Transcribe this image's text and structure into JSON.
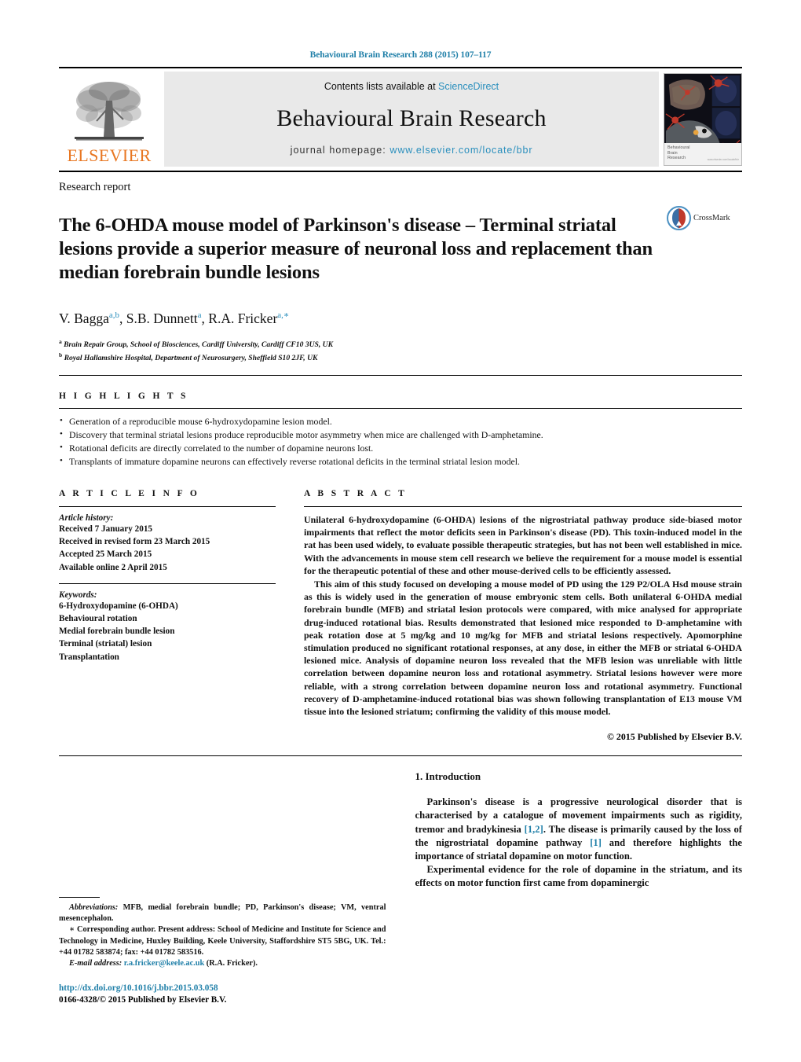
{
  "running_head": "Behavioural Brain Research 288 (2015) 107–117",
  "masthead": {
    "publisher_name": "ELSEVIER",
    "contents_prefix": "Contents lists available at ",
    "contents_link": "ScienceDirect",
    "journal_title": "Behavioural Brain Research",
    "homepage_prefix": "journal homepage: ",
    "homepage_url": "www.elsevier.com/locate/bbr",
    "cover_caption_line1": "Behavioural",
    "cover_caption_line2": "Brain",
    "cover_caption_line3": "Research",
    "cover_caption_tiny": "www.elsevier.com/locate/bbr"
  },
  "article": {
    "type_label": "Research report",
    "title": "The 6-OHDA mouse model of Parkinson's disease – Terminal striatal lesions provide a superior measure of neuronal loss and replacement than median forebrain bundle lesions",
    "crossmark_label": "CrossMark",
    "authors_html": "V. Bagga<sup>a,b</sup>, S.B. Dunnett<sup>a</sup>, R.A. Fricker<sup>a,<span class=\"ast\">∗</span></sup>",
    "affiliations": [
      {
        "marker": "a",
        "text": "Brain Repair Group, School of Biosciences, Cardiff University, Cardiff CF10 3US, UK"
      },
      {
        "marker": "b",
        "text": "Royal Hallamshire Hospital, Department of Neurosurgery, Sheffield S10 2JF, UK"
      }
    ]
  },
  "highlights": {
    "label": "H I G H L I G H T S",
    "items": [
      "Generation of a reproducible mouse 6-hydroxydopamine lesion model.",
      "Discovery that terminal striatal lesions produce reproducible motor asymmetry when mice are challenged with D-amphetamine.",
      "Rotational deficits are directly correlated to the number of dopamine neurons lost.",
      "Transplants of immature dopamine neurons can effectively reverse rotational deficits in the terminal striatal lesion model."
    ]
  },
  "article_info": {
    "label": "A R T I C L E    I N F O",
    "history_label": "Article history:",
    "history": [
      "Received 7 January 2015",
      "Received in revised form 23 March 2015",
      "Accepted 25 March 2015",
      "Available online 2 April 2015"
    ],
    "keywords_label": "Keywords:",
    "keywords": [
      "6-Hydroxydopamine (6-OHDA)",
      "Behavioural rotation",
      "Medial forebrain bundle lesion",
      "Terminal (striatal) lesion",
      "Transplantation"
    ]
  },
  "abstract": {
    "label": "A B S T R A C T",
    "paragraph_1": "Unilateral 6-hydroxydopamine (6-OHDA) lesions of the nigrostriatal pathway produce side-biased motor impairments that reflect the motor deficits seen in Parkinson's disease (PD). This toxin-induced model in the rat has been used widely, to evaluate possible therapeutic strategies, but has not been well established in mice. With the advancements in mouse stem cell research we believe the requirement for a mouse model is essential for the therapeutic potential of these and other mouse-derived cells to be efficiently assessed.",
    "paragraph_2": "This aim of this study focused on developing a mouse model of PD using the 129 P2/OLA Hsd mouse strain as this is widely used in the generation of mouse embryonic stem cells. Both unilateral 6-OHDA medial forebrain bundle (MFB) and striatal lesion protocols were compared, with mice analysed for appropriate drug-induced rotational bias. Results demonstrated that lesioned mice responded to D-amphetamine with peak rotation dose at 5 mg/kg and 10 mg/kg for MFB and striatal lesions respectively. Apomorphine stimulation produced no significant rotational responses, at any dose, in either the MFB or striatal 6-OHDA lesioned mice. Analysis of dopamine neuron loss revealed that the MFB lesion was unreliable with little correlation between dopamine neuron loss and rotational asymmetry. Striatal lesions however were more reliable, with a strong correlation between dopamine neuron loss and rotational asymmetry. Functional recovery of D-amphetamine-induced rotational bias was shown following transplantation of E13 mouse VM tissue into the lesioned striatum; confirming the validity of this mouse model.",
    "copyright": "© 2015 Published by Elsevier B.V."
  },
  "introduction": {
    "heading": "1.  Introduction",
    "paragraph_1_a": "Parkinson's disease is a progressive neurological disorder that is characterised by a catalogue of movement impairments such as rigidity, tremor and bradykinesia ",
    "paragraph_1_ref1": "[1,2]",
    "paragraph_1_b": ". The disease is primarily caused by the loss of the nigrostriatal dopamine pathway ",
    "paragraph_1_ref2": "[1]",
    "paragraph_1_c": " and therefore highlights the importance of striatal dopamine on motor function.",
    "paragraph_2": "Experimental evidence for the role of dopamine in the striatum, and its effects on motor function first came from dopaminergic"
  },
  "footnotes": {
    "abbreviations_label": "Abbreviations:",
    "abbreviations_text": " MFB, medial forebrain bundle; PD, Parkinson's disease; VM, ventral mesencephalon.",
    "corresponding_marker": "∗",
    "corresponding_text": " Corresponding author. Present address: School of Medicine and Institute for Science and Technology in Medicine, Huxley Building, Keele University, Staffordshire ST5 5BG, UK. Tel.: +44 01782 583874; fax: +44 01782 583516.",
    "email_label": "E-mail address:",
    "email": "r.a.fricker@keele.ac.uk",
    "email_suffix": " (R.A. Fricker).",
    "doi": "http://dx.doi.org/10.1016/j.bbr.2015.03.058",
    "issn_line": "0166-4328/© 2015 Published by Elsevier B.V."
  },
  "colors": {
    "link_blue": "#1f7fa8",
    "science_direct_blue": "#2a8fbd",
    "elsevier_orange": "#e87722"
  }
}
